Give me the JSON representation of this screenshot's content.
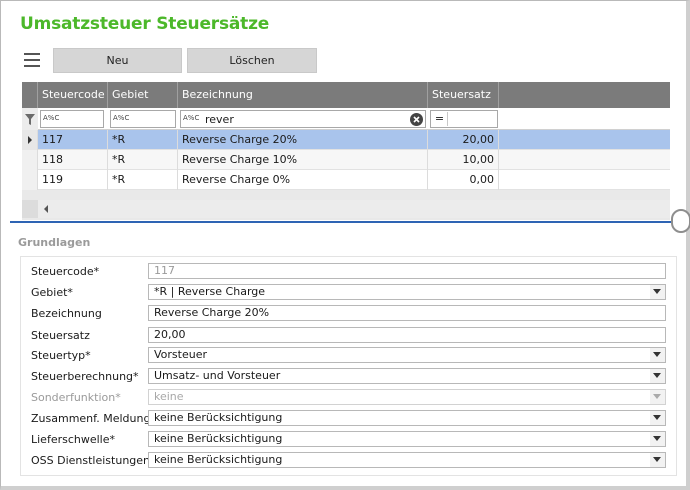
{
  "page": {
    "title": "Umsatzsteuer Steuersätze"
  },
  "toolbar": {
    "new_label": "Neu",
    "delete_label": "Löschen",
    "menu_icon": "hamburger-icon"
  },
  "grid": {
    "columns": [
      "Steuercode",
      "Gebiet",
      "Bezeichnung",
      "Steuersatz"
    ],
    "filter": {
      "prefix": "A%C",
      "bezeichnung_value": "rever",
      "steuersatz_operator": "="
    },
    "rows": [
      {
        "code": "117",
        "gebiet": "*R",
        "bezeichnung": "Reverse Charge 20%",
        "satz": "20,00",
        "selected": true
      },
      {
        "code": "118",
        "gebiet": "*R",
        "bezeichnung": "Reverse Charge 10%",
        "satz": "10,00",
        "selected": false
      },
      {
        "code": "119",
        "gebiet": "*R",
        "bezeichnung": "Reverse Charge 0%",
        "satz": "0,00",
        "selected": false
      }
    ]
  },
  "form": {
    "section_title": "Grundlagen",
    "fields": [
      {
        "label": "Steuercode*",
        "value": "117",
        "kind": "readonly"
      },
      {
        "label": "Gebiet*",
        "value": "*R  |  Reverse Charge",
        "kind": "select"
      },
      {
        "label": "Bezeichnung",
        "value": "Reverse Charge 20%",
        "kind": "text"
      },
      {
        "label": "Steuersatz",
        "value": "20,00",
        "kind": "text"
      },
      {
        "label": "Steuertyp*",
        "value": "Vorsteuer",
        "kind": "select"
      },
      {
        "label": "Steuerberechnung*",
        "value": "Umsatz- und Vorsteuer",
        "kind": "select"
      },
      {
        "label": "Sonderfunktion*",
        "value": "keine",
        "kind": "select-disabled"
      },
      {
        "label": "Zusammenf. Meldung*",
        "value": "keine Berücksichtigung",
        "kind": "select"
      },
      {
        "label": "Lieferschwelle*",
        "value": "keine Berücksichtigung",
        "kind": "select"
      },
      {
        "label": "OSS Dienstleistungen*",
        "value": "keine Berücksichtigung",
        "kind": "select"
      }
    ]
  }
}
